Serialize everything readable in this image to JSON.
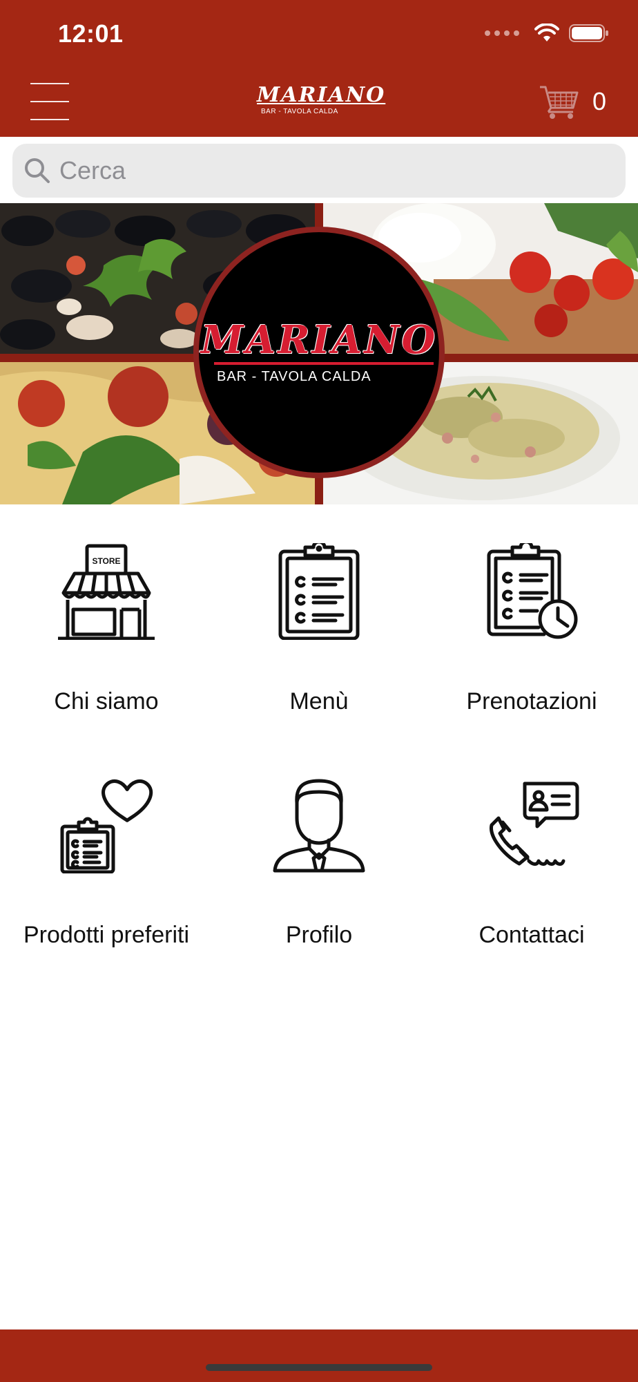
{
  "status_bar": {
    "time": "12:01"
  },
  "header": {
    "logo_name": "MARIANO",
    "logo_sub": "BAR - TAVOLA CALDA",
    "cart_count": "0",
    "brand_color": "#a42714"
  },
  "search": {
    "placeholder": "Cerca"
  },
  "hero": {
    "logo_name": "MARIANO",
    "logo_sub": "BAR - TAVOLA CALDA"
  },
  "menu_tiles": [
    {
      "label": "Chi siamo",
      "icon": "store-icon"
    },
    {
      "label": "Menù",
      "icon": "clipboard-list-icon"
    },
    {
      "label": "Prenotazioni",
      "icon": "clipboard-clock-icon"
    },
    {
      "label": "Prodotti preferiti",
      "icon": "favorites-list-icon"
    },
    {
      "label": "Profilo",
      "icon": "user-profile-icon"
    },
    {
      "label": "Contattaci",
      "icon": "phone-contact-icon"
    }
  ]
}
